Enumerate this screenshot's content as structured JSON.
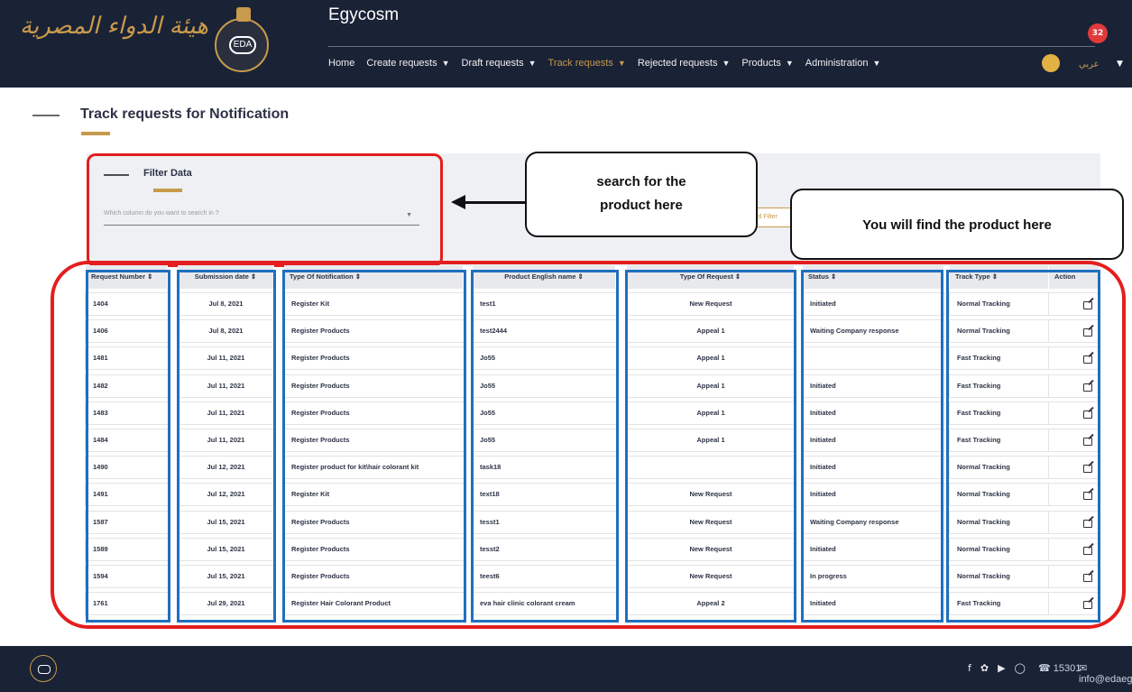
{
  "header": {
    "logo_text_ar": "هيئة الدواء المصرية",
    "logo_badge": "EDA",
    "app_title": "Egycosm",
    "notification_count": "32",
    "language": "عربي",
    "nav": [
      {
        "label": "Home",
        "has_chevron": false
      },
      {
        "label": "Create requests",
        "has_chevron": true
      },
      {
        "label": "Draft requests",
        "has_chevron": true
      },
      {
        "label": "Track requests",
        "has_chevron": true,
        "active": true
      },
      {
        "label": "Rejected requests",
        "has_chevron": true
      },
      {
        "label": "Products",
        "has_chevron": true
      },
      {
        "label": "Administration",
        "has_chevron": true
      }
    ]
  },
  "page": {
    "title": "Track requests for Notification"
  },
  "filter": {
    "title": "Filter Data",
    "select_placeholder": "Which column do you want to search in ?",
    "add_filter_label": "Add Filter"
  },
  "callouts": {
    "search": "search for the product here",
    "found": "You will find the product here"
  },
  "table": {
    "headers": [
      "Request Number ⇕",
      "Submission date ⇕",
      "Type Of Notification ⇕",
      "Product English name ⇕",
      "Type Of Request ⇕",
      "Status ⇕",
      "Track Type ⇕",
      "Action"
    ],
    "rows": [
      {
        "request_number": "1404",
        "submission_date": "Jul 8, 2021",
        "notification_type": "Register Kit",
        "product_name": "test1",
        "request_type": "New Request",
        "status": "Initiated",
        "track_type": "Normal Tracking"
      },
      {
        "request_number": "1406",
        "submission_date": "Jul 8, 2021",
        "notification_type": "Register Products",
        "product_name": "test2444",
        "request_type": "Appeal 1",
        "status": "Waiting Company response",
        "track_type": "Normal Tracking"
      },
      {
        "request_number": "1481",
        "submission_date": "Jul 11, 2021",
        "notification_type": "Register Products",
        "product_name": "Jo55",
        "request_type": "Appeal 1",
        "status": "",
        "track_type": "Fast Tracking"
      },
      {
        "request_number": "1482",
        "submission_date": "Jul 11, 2021",
        "notification_type": "Register Products",
        "product_name": "Jo55",
        "request_type": "Appeal 1",
        "status": "Initiated",
        "track_type": "Fast Tracking"
      },
      {
        "request_number": "1483",
        "submission_date": "Jul 11, 2021",
        "notification_type": "Register Products",
        "product_name": "Jo55",
        "request_type": "Appeal 1",
        "status": "Initiated",
        "track_type": "Fast Tracking"
      },
      {
        "request_number": "1484",
        "submission_date": "Jul 11, 2021",
        "notification_type": "Register Products",
        "product_name": "Jo55",
        "request_type": "Appeal 1",
        "status": "Initiated",
        "track_type": "Fast Tracking"
      },
      {
        "request_number": "1490",
        "submission_date": "Jul 12, 2021",
        "notification_type": "Register product for kit\\hair colorant kit",
        "product_name": "task18",
        "request_type": "",
        "status": "Initiated",
        "track_type": "Normal Tracking"
      },
      {
        "request_number": "1491",
        "submission_date": "Jul 12, 2021",
        "notification_type": "Register Kit",
        "product_name": "text18",
        "request_type": "New Request",
        "status": "Initiated",
        "track_type": "Normal Tracking"
      },
      {
        "request_number": "1587",
        "submission_date": "Jul 15, 2021",
        "notification_type": "Register Products",
        "product_name": "tesst1",
        "request_type": "New Request",
        "status": "Waiting Company response",
        "track_type": "Normal Tracking"
      },
      {
        "request_number": "1589",
        "submission_date": "Jul 15, 2021",
        "notification_type": "Register Products",
        "product_name": "tesst2",
        "request_type": "New Request",
        "status": "Initiated",
        "track_type": "Normal Tracking"
      },
      {
        "request_number": "1594",
        "submission_date": "Jul 15, 2021",
        "notification_type": "Register Products",
        "product_name": "teest6",
        "request_type": "New Request",
        "status": "In progress",
        "track_type": "Normal Tracking"
      },
      {
        "request_number": "1761",
        "submission_date": "Jul 29, 2021",
        "notification_type": "Register Hair Colorant Product",
        "product_name": "eva hair clinic colorant cream",
        "request_type": "Appeal 2",
        "status": "Initiated",
        "track_type": "Fast Tracking"
      }
    ]
  },
  "footer": {
    "social_icons": [
      "facebook-icon",
      "twitter-icon",
      "youtube-icon",
      "instagram-icon"
    ],
    "phone": "15301",
    "email": "info@edaegypt.gov.eg"
  },
  "colors": {
    "header_bg": "#1a2236",
    "gold": "#c89a4b",
    "annotation_red": "#e41e1e",
    "annotation_blue": "#1f6fbf"
  }
}
